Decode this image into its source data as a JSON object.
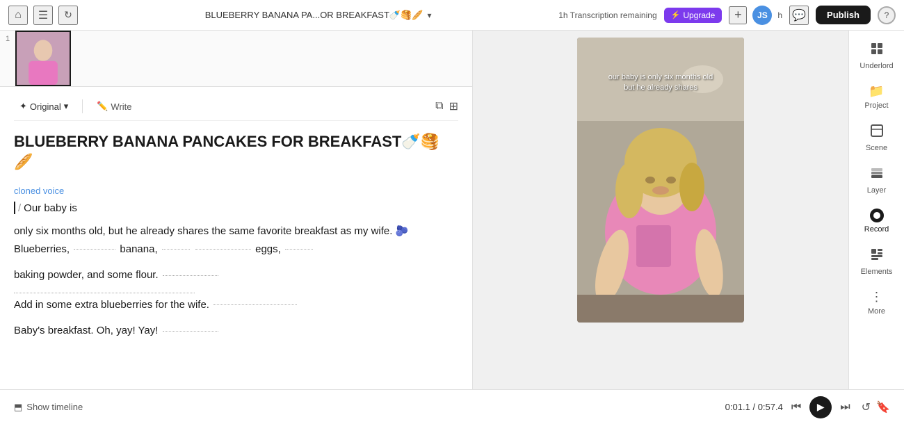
{
  "topbar": {
    "home_icon": "⌂",
    "menu_icon": "☰",
    "refresh_icon": "↻",
    "project_title": "BLUEBERRY BANANA PA...OR BREAKFAST🍼🥞🥖",
    "chevron": "▾",
    "transcription": "1h  Transcription remaining",
    "upgrade_label": "Upgrade",
    "lightning": "⚡",
    "add_icon": "+",
    "avatar_initials": "JS",
    "user_label": "h",
    "chat_icon": "💬",
    "publish_label": "Publish",
    "help_icon": "?"
  },
  "script_toolbar": {
    "original_label": "Original",
    "original_icon": "✦",
    "write_label": "Write",
    "write_icon": "✏️",
    "copy_icon": "⧉",
    "layout_icon": "⊞"
  },
  "script": {
    "title": "BLUEBERRY BANANA PANCAKES FOR BREAKFAST🍼🥞🥖",
    "cloned_voice_label": "cloned voice",
    "cursor_text": "Our baby is",
    "paragraph1": "only six months old, but he already shares the same favorite breakfast as my wife. 🫐 Blueberries,  banana,  eggs,",
    "paragraph2": "baking powder, and some flour.",
    "paragraph3": "Add in some extra blueberries for the wife.",
    "paragraph4": "Baby's breakfast. Oh, yay! Yay!"
  },
  "video": {
    "overlay_text": "our baby is only six months old but he already shares",
    "placeholder_bg": "#3a3a3a"
  },
  "sidebar": {
    "items": [
      {
        "id": "underlord",
        "icon": "⊞",
        "label": "Underlord"
      },
      {
        "id": "project",
        "icon": "📁",
        "label": "Project"
      },
      {
        "id": "scene",
        "icon": "⬜",
        "label": "Scene"
      },
      {
        "id": "layer",
        "icon": "◫",
        "label": "Layer"
      },
      {
        "id": "record",
        "icon": "⏺",
        "label": "Record"
      },
      {
        "id": "elements",
        "icon": "✦",
        "label": "Elements"
      },
      {
        "id": "more",
        "icon": "⋮",
        "label": "More"
      }
    ]
  },
  "bottom_bar": {
    "timeline_icon": "⬒",
    "timeline_label": "Show timeline",
    "time_current": "0:01.1",
    "time_separator": "/",
    "time_total": "0:57.4",
    "skip_back_icon": "⏮",
    "play_icon": "▶",
    "skip_forward_icon": "⏭",
    "loop_icon": "↺",
    "bookmark_icon": "🔖"
  }
}
